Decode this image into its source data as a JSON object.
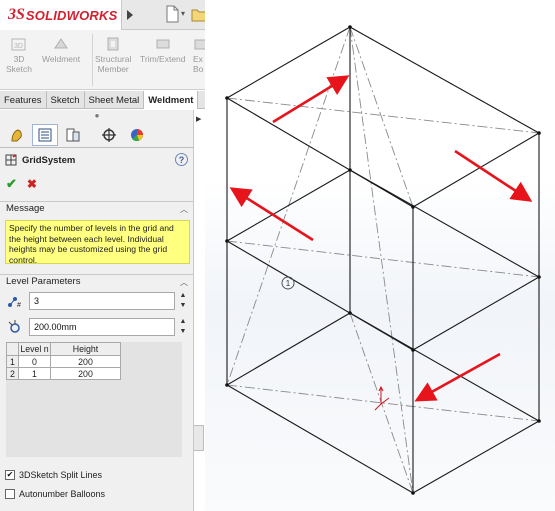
{
  "app": {
    "brand_prefix": "3S",
    "brand_name": "SOLIDWORKS"
  },
  "ribbon": {
    "buttons": [
      {
        "label_line1": "3D",
        "label_line2": "Sketch",
        "icon": "sketch-3d-icon"
      },
      {
        "label_line1": "Weldment",
        "label_line2": "",
        "icon": "weldment-icon"
      },
      {
        "label_line1": "Structural",
        "label_line2": "Member",
        "icon": "structural-member-icon"
      },
      {
        "label_line1": "Trim/Extend",
        "label_line2": "",
        "icon": "trim-extend-icon"
      },
      {
        "label_line1": "Ex",
        "label_line2": "Bo",
        "icon": "extruded-boss-icon"
      }
    ]
  },
  "command_tabs": [
    "Features",
    "Sketch",
    "Sheet Metal",
    "Weldment"
  ],
  "command_tabs_active": "Weldment",
  "property_manager": {
    "title": "GridSystem",
    "help": "?",
    "message_header": "Message",
    "message": "Specify the number of levels in the grid and the height between each level.  Individual heights may be customized using the grid control.",
    "level_header": "Level Parameters",
    "level_count": "3",
    "level_height": "200.00mm",
    "table": {
      "headers": [
        "Level n",
        "Height"
      ],
      "rows": [
        {
          "row": "1",
          "level": "0",
          "height": "200"
        },
        {
          "row": "2",
          "level": "1",
          "height": "200"
        }
      ]
    },
    "checkbox_split": {
      "label": "3DSketch Split Lines",
      "checked": true
    },
    "checkbox_balloons": {
      "label": "Autonumber Balloons",
      "checked": false
    }
  },
  "viewport": {
    "balloon_label": "1",
    "colors": {
      "edge": "#1a1a1a",
      "construction": "#8a8a8a",
      "arrow": "#e8141c",
      "origin": "#d0121b"
    }
  }
}
